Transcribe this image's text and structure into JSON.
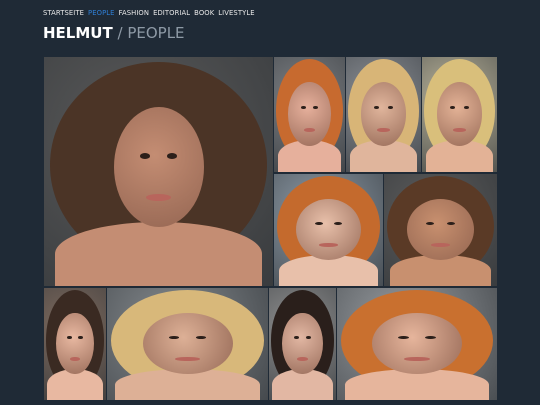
{
  "nav": {
    "items": [
      "STARTSEITE",
      "PEOPLE",
      "FASHION",
      "EDITORIAL",
      "BOOK",
      "LIVESTYLE"
    ],
    "active_index": 1
  },
  "header": {
    "brand": "HELMUT",
    "separator": "/",
    "page": "PEOPLE"
  },
  "gallery": {
    "photos": [
      {
        "name": "photo-curly-brunette-profile",
        "bg": "#5a5a5a",
        "hair": "#4b3426",
        "skin": "#c48d73"
      },
      {
        "name": "photo-red-hair-hand-face",
        "bg": "#7c7f83",
        "hair": "#c76a2f",
        "skin": "#e6b09c"
      },
      {
        "name": "photo-blonde-curly-bare-shoulders",
        "bg": "#8b8f95",
        "hair": "#d8b577",
        "skin": "#e0b59c"
      },
      {
        "name": "photo-long-blonde-hair",
        "bg": "#b9b39a",
        "hair": "#d9bf7b",
        "skin": "#e3b296"
      },
      {
        "name": "photo-windblown-red-hair",
        "bg": "#8d9aa6",
        "hair": "#c46a2d",
        "skin": "#e8c0aa"
      },
      {
        "name": "photo-freckled-curly-closeup",
        "bg": "#5c5c5c",
        "hair": "#5a3a26",
        "skin": "#c8906f"
      },
      {
        "name": "photo-dark-bob-closeup",
        "bg": "#7d6a5e",
        "hair": "#3a2a22",
        "skin": "#e8b8a1"
      },
      {
        "name": "photo-blonde-smiling",
        "bg": "#868b8f",
        "hair": "#d8b87a",
        "skin": "#ddb096"
      },
      {
        "name": "photo-dark-bangs-portrait",
        "bg": "#8f8f8f",
        "hair": "#2a1f1b",
        "skin": "#e2b7a3"
      },
      {
        "name": "photo-ginger-windblown",
        "bg": "#9a9ea2",
        "hair": "#c9702f",
        "skin": "#e6b59c"
      }
    ]
  }
}
